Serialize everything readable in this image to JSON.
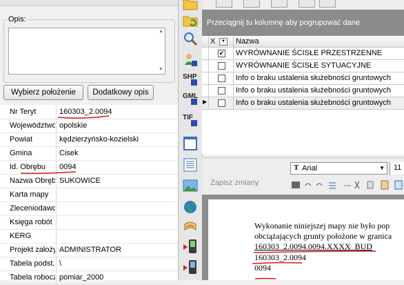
{
  "left_panel": {
    "opis_label": "Opis:",
    "buttons": {
      "select_location": "Wybierz położenie",
      "additional_description": "Dodatkowy opis"
    },
    "properties": [
      {
        "label": "Nr Teryt",
        "value": "160303_2.0094"
      },
      {
        "label": "Województwo",
        "value": "opolskie"
      },
      {
        "label": "Powiat",
        "value": "kędzierzyńsko-kozielski"
      },
      {
        "label": "Gmina",
        "value": "Cisek"
      },
      {
        "label": "Id. Obrębu",
        "value": "0094"
      },
      {
        "label": "Nazwa Obrębu",
        "value": "SUKOWICE"
      },
      {
        "label": "Karta mapy",
        "value": ""
      },
      {
        "label": "Zleceniodawca",
        "value": ""
      },
      {
        "label": "Księga robót",
        "value": ""
      },
      {
        "label": "KERG",
        "value": ""
      },
      {
        "label": "Projekt założył",
        "value": "ADMINISTRATOR"
      },
      {
        "label": "Tabela podst.",
        "value": "\\"
      },
      {
        "label": "Tabela robocza",
        "value": "pomiar_2000"
      }
    ]
  },
  "iconbar": {
    "icons": [
      "folder-icon",
      "folder-refresh-icon",
      "magnifier-icon",
      "user-save-icon",
      "shp-export-icon",
      "gml-export-icon",
      "tif-export-icon",
      "blank-doc-icon",
      "text-doc-icon",
      "picture-icon",
      "globe-icon",
      "map-scroll-icon",
      "phone-export-icon",
      "phone-import-icon"
    ],
    "shp_label": "SHP",
    "gml_label": "GML",
    "tif_label": "TIF"
  },
  "grid": {
    "group_hint": "Przeciągnij tu kolumnę aby pogrupować dane",
    "header": {
      "check_col": "X",
      "name_col": "Nazwa"
    },
    "rows": [
      {
        "checked": true,
        "name": "WYRÓWNANIE ŚCISŁE PRZESTRZENNE"
      },
      {
        "checked": false,
        "name": "WYRÓWNANIE ŚCISŁE SYTUACYJNE"
      },
      {
        "checked": false,
        "name": "Info o braku ustalenia służebności gruntowych"
      },
      {
        "checked": false,
        "name": "Info o braku ustalenia służebności gruntowych"
      },
      {
        "checked": false,
        "name": "Info o braku ustalenia służebności gruntowych",
        "current": true
      }
    ]
  },
  "editor": {
    "save_label": "Zapisz zmiany",
    "font_name": "Arial",
    "font_size": "11",
    "document_lines": [
      "Wykonanie niniejszej mapy nie było pop",
      "obciążających grunty położone w granica",
      "160303_2.0094.0094.XXXX_BUD",
      "160303_2.0094",
      "0094"
    ]
  },
  "colors": {
    "annotation_red": "#d81818",
    "group_bar": "#8c8c8c"
  }
}
